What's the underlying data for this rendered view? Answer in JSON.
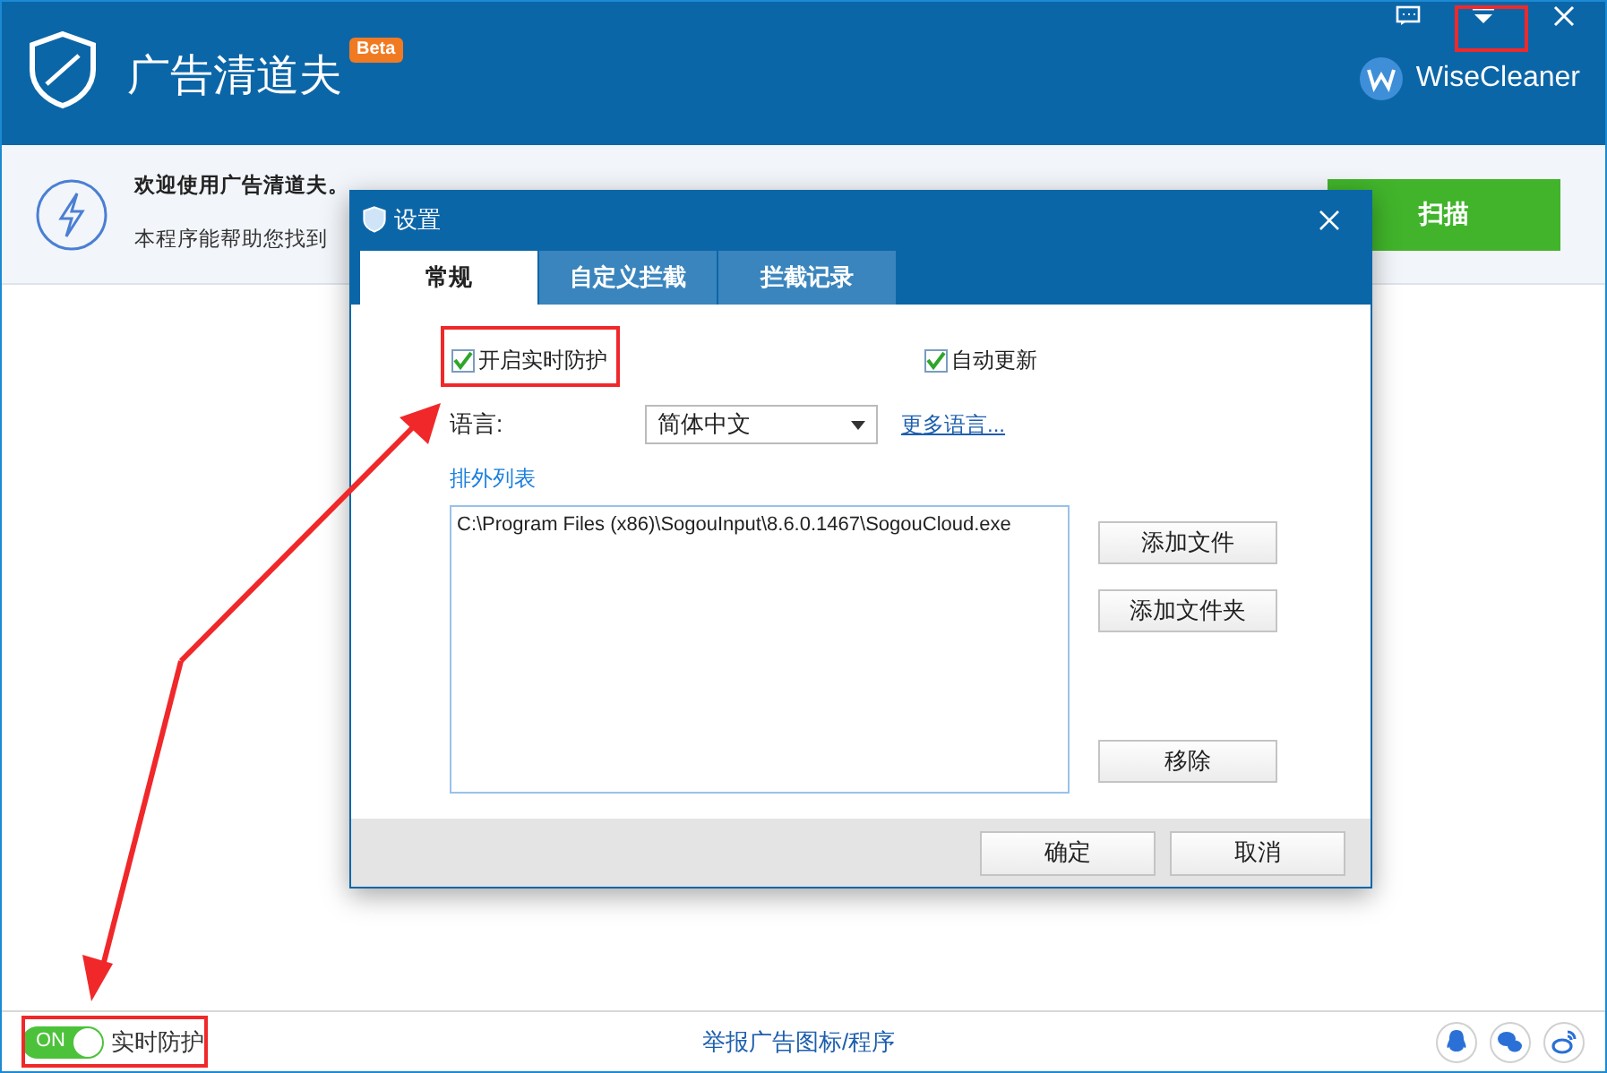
{
  "app": {
    "title": "广告清道夫",
    "badge": "Beta",
    "brand": "WiseCleaner"
  },
  "banner": {
    "heading": "欢迎使用广告清道夫。",
    "text": "本程序能帮助您找到",
    "scan_button": "扫描"
  },
  "dialog": {
    "title": "设置",
    "tabs": [
      {
        "label": "常规",
        "selected": true
      },
      {
        "label": "自定义拦截",
        "selected": false
      },
      {
        "label": "拦截记录",
        "selected": false
      }
    ],
    "checkboxes": [
      {
        "label": "开启实时防护",
        "checked": true
      },
      {
        "label": "自动更新",
        "checked": true
      }
    ],
    "language_label": "语言:",
    "language_value": "简体中文",
    "more_languages": "更多语言...",
    "exclusion_label": "排外列表",
    "exclusions": [
      "C:\\Program Files (x86)\\SogouInput\\8.6.0.1467\\SogouCloud.exe"
    ],
    "side_buttons": [
      "添加文件",
      "添加文件夹",
      "移除"
    ],
    "buttons": [
      "确定",
      "取消"
    ]
  },
  "footer": {
    "toggle": {
      "label": "ON",
      "on": true
    },
    "toggle_caption": "实时防护",
    "report_link": "举报广告图标/程序"
  }
}
